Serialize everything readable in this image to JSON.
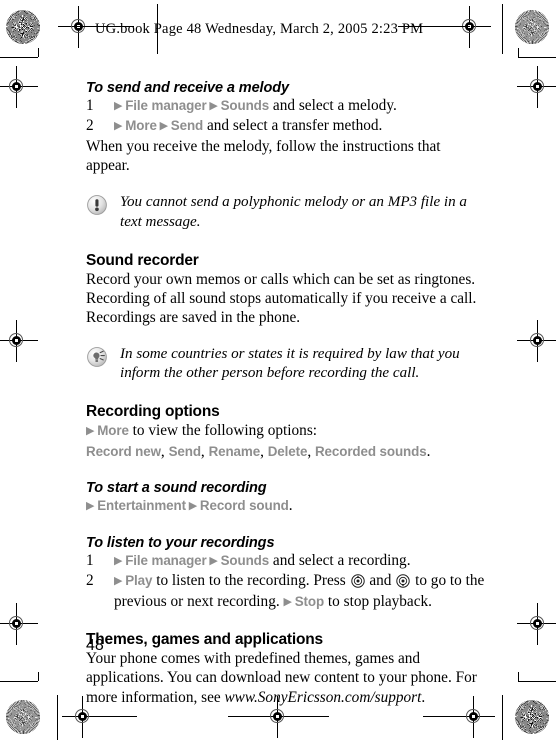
{
  "page_header": {
    "text": "UG.book  Page 48  Wednesday, March 2, 2005  2:23 PM"
  },
  "colors": {
    "ui_term_gray": "#8e8e8e",
    "body_text": "#000000",
    "page_background": "#ffffff"
  },
  "sections": {
    "send_receive_melody": {
      "heading": "To send and receive a melody",
      "steps": [
        {
          "num": "1",
          "arrow1": "▶",
          "ui1": "File manager",
          "arrow2": "▶",
          "ui2": "Sounds",
          "tail": " and select a melody."
        },
        {
          "num": "2",
          "arrow1": "▶",
          "ui1": "More",
          "arrow2": "▶",
          "ui2": "Send",
          "tail": " and select a transfer method."
        }
      ],
      "after_text": "When you receive the melody, follow the instructions that appear."
    },
    "note_melody": {
      "icon": "note-exclamation-icon",
      "text": "You cannot send a polyphonic melody or an MP3 file in a text message."
    },
    "sound_recorder": {
      "heading": "Sound recorder",
      "body": "Record your own memos or calls which can be set as ringtones. Recording of all sound stops automatically if you receive a call. Recordings are saved in the phone."
    },
    "note_recording_law": {
      "icon": "note-tip-icon",
      "text": "In some countries or states it is required by law that you inform the other person before recording the call."
    },
    "recording_options": {
      "heading": "Recording options",
      "line1": {
        "arrow": "▶",
        "ui": "More",
        "tail": " to view the following options:"
      },
      "options": [
        "Record new",
        "Send",
        "Rename",
        "Delete",
        "Recorded sounds"
      ],
      "options_separator": ", ",
      "options_terminator": "."
    },
    "start_sound_recording": {
      "heading": "To start a sound recording",
      "line": {
        "arrow1": "▶",
        "ui1": "Entertainment",
        "arrow2": "▶",
        "ui2": "Record sound",
        "tail": "."
      }
    },
    "listen_recordings": {
      "heading": "To listen to your recordings",
      "steps": [
        {
          "num": "1",
          "arrow1": "▶",
          "ui1": "File manager",
          "arrow2": "▶",
          "ui2": "Sounds",
          "tail": " and select a recording."
        },
        {
          "num": "2",
          "arrow1": "▶",
          "ui1": "Play",
          "mid1": " to listen to the recording. Press ",
          "key_up": "nav-key-up-icon",
          "mid2": " and ",
          "key_down": "nav-key-down-icon",
          "mid3": " to go to the previous or next recording. ",
          "arrow2": "▶",
          "ui2": "Stop",
          "tail": " to stop playback."
        }
      ]
    },
    "themes_games": {
      "heading": "Themes, games and applications",
      "body_part1": "Your phone comes with predefined themes, games and applications. You can download new content to your phone. For more information, see ",
      "url": "www.SonyEricsson.com/support",
      "body_part2": "."
    }
  },
  "footer": {
    "page_number": "48"
  }
}
